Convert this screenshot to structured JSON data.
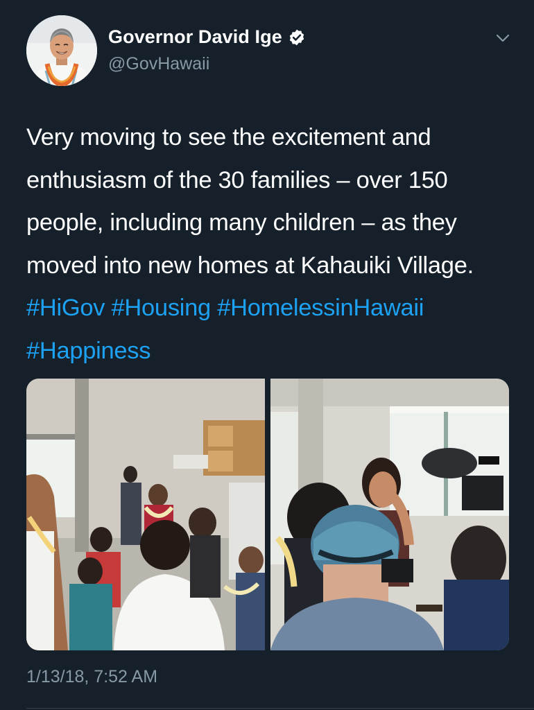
{
  "author": {
    "display_name": "Governor David Ige",
    "handle": "@GovHawaii",
    "verified": true,
    "avatar_icon": "profile-photo"
  },
  "tweet": {
    "text_plain": "Very moving to see the excitement and enthusiasm of the 30 families – over 150 people, including many children – as they moved into new homes at Kahauiki Village. ",
    "hashtags": [
      "#HiGov",
      "#Housing",
      "#HomelessinHawaii",
      "#Happiness"
    ]
  },
  "media": [
    {
      "description_icon": "photo-families-kitchen"
    },
    {
      "description_icon": "photo-woman-crying-camera"
    }
  ],
  "timestamp": "1/13/18, 7:52 AM",
  "colors": {
    "background": "#15202b",
    "text": "#ffffff",
    "secondary_text": "#8899a6",
    "link": "#1da1f2",
    "divider": "#38444d"
  }
}
